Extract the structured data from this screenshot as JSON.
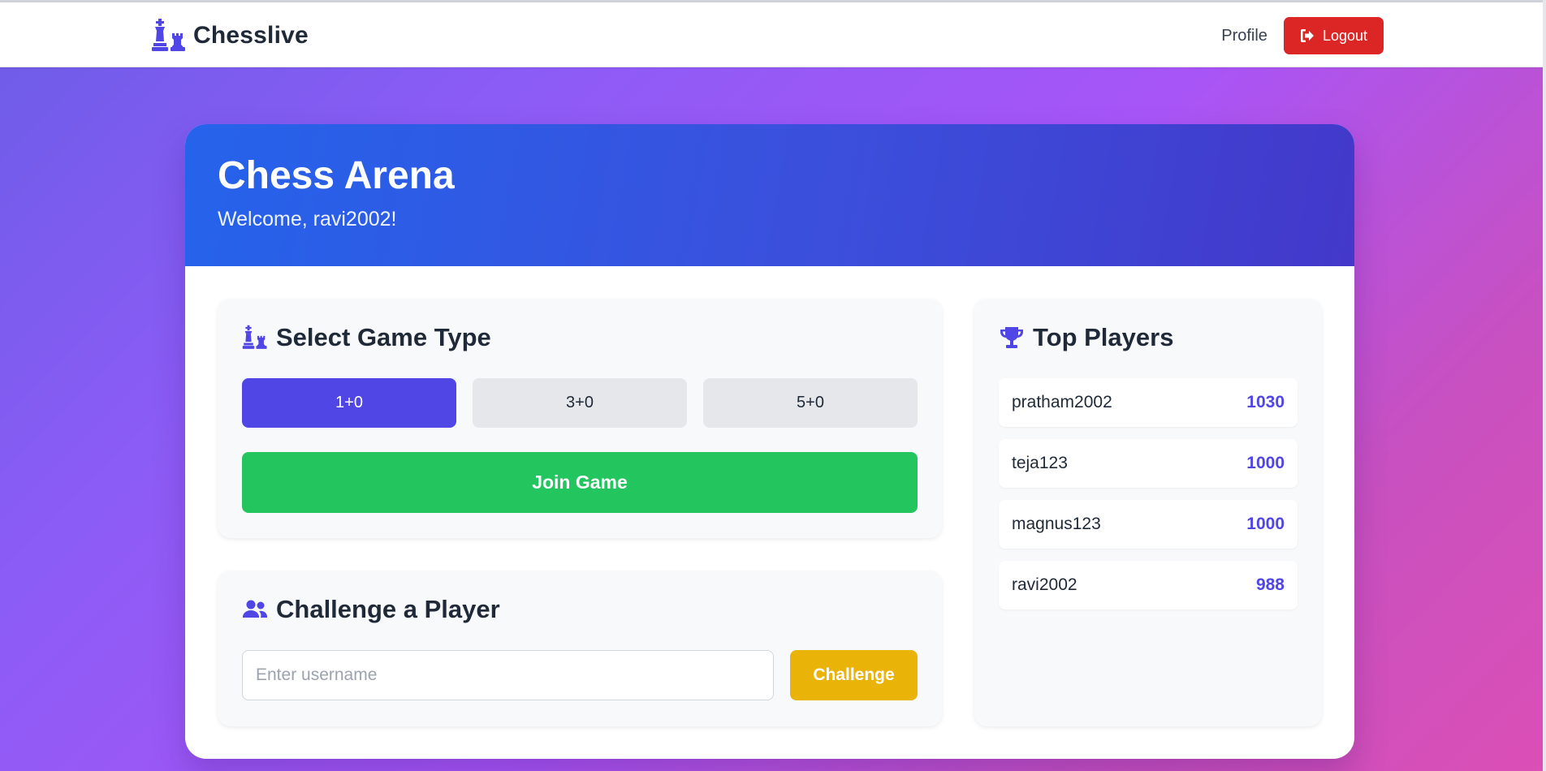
{
  "navbar": {
    "brand": "Chesslive",
    "profile_label": "Profile",
    "logout_label": "Logout"
  },
  "hero": {
    "title": "Chess Arena",
    "welcome": "Welcome, ravi2002!"
  },
  "game_type": {
    "title": "Select Game Type",
    "options": [
      {
        "label": "1+0",
        "selected": true
      },
      {
        "label": "3+0",
        "selected": false
      },
      {
        "label": "5+0",
        "selected": false
      }
    ],
    "join_label": "Join Game"
  },
  "challenge": {
    "title": "Challenge a Player",
    "input_value": "",
    "input_placeholder": "Enter username",
    "button_label": "Challenge"
  },
  "leaderboard": {
    "title": "Top Players",
    "players": [
      {
        "name": "pratham2002",
        "rating": "1030"
      },
      {
        "name": "teja123",
        "rating": "1000"
      },
      {
        "name": "magnus123",
        "rating": "1000"
      },
      {
        "name": "ravi2002",
        "rating": "988"
      }
    ]
  },
  "icons": {
    "brand": "chess-pieces-icon",
    "logout": "sign-out-icon",
    "game_type": "chess-pieces-icon",
    "challenge": "users-icon",
    "leaderboard": "trophy-icon"
  },
  "colors": {
    "accent": "#4f46e5",
    "logout": "#dc2626",
    "join": "#22c55e",
    "challenge": "#eab308",
    "hero_start": "#2563eb",
    "hero_end": "#4338ca"
  }
}
